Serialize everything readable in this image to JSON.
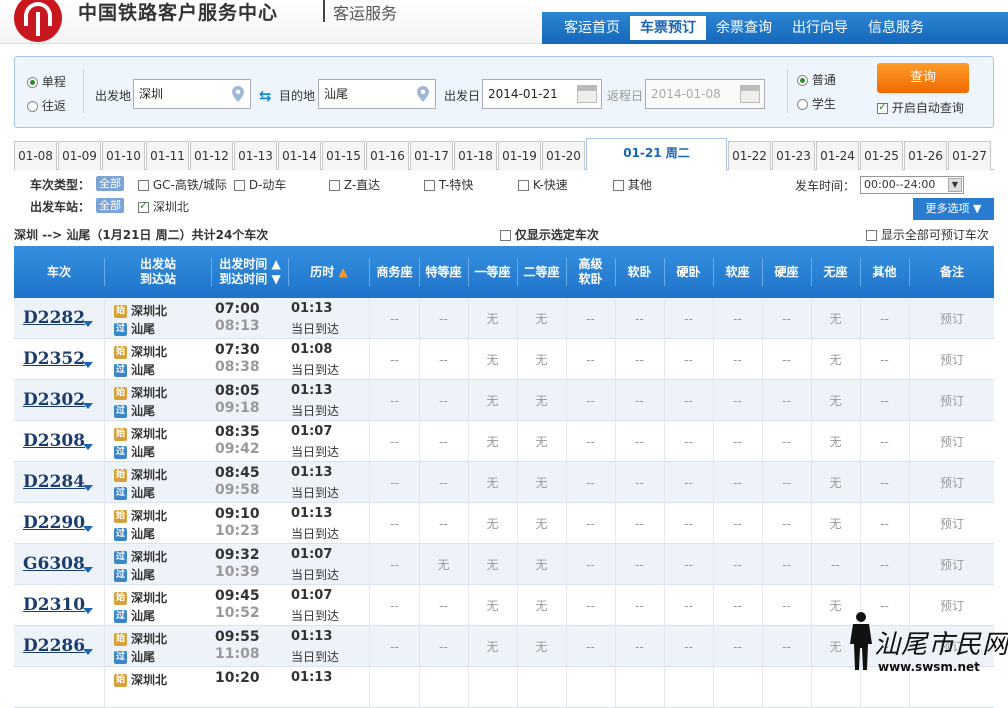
{
  "header": {
    "site_title": "中国铁路客户服务中心",
    "site_sub": "客运服务",
    "nav": [
      "客运首页",
      "车票预订",
      "余票查询",
      "出行向导",
      "信息服务"
    ],
    "active_nav": 1
  },
  "search": {
    "trip_types": [
      "单程",
      "往返"
    ],
    "from_label": "出发地",
    "from_value": "深圳",
    "to_label": "目的地",
    "to_value": "汕尾",
    "date_label": "出发日",
    "date_value": "2014-01-21",
    "return_label": "返程日",
    "return_value": "2014-01-08",
    "passenger_types": [
      "普通",
      "学生"
    ],
    "query_button": "查询",
    "auto_query_label": "开启自动查询"
  },
  "date_tabs": [
    "01-08",
    "01-09",
    "01-10",
    "01-11",
    "01-12",
    "01-13",
    "01-14",
    "01-15",
    "01-16",
    "01-17",
    "01-18",
    "01-19",
    "01-20",
    "01-21 周二",
    "01-22",
    "01-23",
    "01-24",
    "01-25",
    "01-26",
    "01-27"
  ],
  "active_date": 13,
  "filters": {
    "type_label": "车次类型：",
    "all_label": "全部",
    "types": [
      "GC-高铁/城际",
      "D-动车",
      "Z-直达",
      "T-特快",
      "K-快速",
      "其他"
    ],
    "station_label": "出发车站：",
    "station_all": "全部",
    "station": "深圳北",
    "time_label": "发车时间：",
    "time_value": "00:00--24:00",
    "more_options": "更多选项"
  },
  "summary": {
    "route": "深圳 --> 汕尾（1月21日  周二）共计24个车次",
    "only_selected": "仅显示选定车次",
    "show_all": "显示全部可预订车次"
  },
  "table": {
    "headers": {
      "train": "车次",
      "station_top": "出发站",
      "station_bottom": "到达站",
      "time_top": "出发时间",
      "time_bottom": "到达时间",
      "duration": "历时",
      "business": "商务座",
      "special": "特等座",
      "first": "一等座",
      "second": "二等座",
      "soft_sleeper_top": "高级",
      "soft_sleeper_bottom": "软卧",
      "soft_sleeper": "软卧",
      "hard_sleeper": "硬卧",
      "soft_seat": "软座",
      "hard_seat": "硬座",
      "no_seat": "无座",
      "other": "其他",
      "remark": "备注"
    },
    "badges": {
      "start": "始",
      "pass": "过"
    },
    "rows": [
      {
        "train": "D2282",
        "from": "深圳北",
        "to": "汕尾",
        "dep": "07:00",
        "arr": "08:13",
        "dur": "01:13",
        "day": "当日到达",
        "seats": [
          "--",
          "--",
          "无",
          "无",
          "--",
          "--",
          "--",
          "--",
          "--",
          "无",
          "--"
        ],
        "remark": "预订"
      },
      {
        "train": "D2352",
        "from": "深圳北",
        "to": "汕尾",
        "dep": "07:30",
        "arr": "08:38",
        "dur": "01:08",
        "day": "当日到达",
        "seats": [
          "--",
          "--",
          "无",
          "无",
          "--",
          "--",
          "--",
          "--",
          "--",
          "无",
          "--"
        ],
        "remark": "预订"
      },
      {
        "train": "D2302",
        "from": "深圳北",
        "to": "汕尾",
        "dep": "08:05",
        "arr": "09:18",
        "dur": "01:13",
        "day": "当日到达",
        "seats": [
          "--",
          "--",
          "无",
          "无",
          "--",
          "--",
          "--",
          "--",
          "--",
          "无",
          "--"
        ],
        "remark": "预订"
      },
      {
        "train": "D2308",
        "from": "深圳北",
        "to": "汕尾",
        "dep": "08:35",
        "arr": "09:42",
        "dur": "01:07",
        "day": "当日到达",
        "seats": [
          "--",
          "--",
          "无",
          "无",
          "--",
          "--",
          "--",
          "--",
          "--",
          "无",
          "--"
        ],
        "remark": "预订"
      },
      {
        "train": "D2284",
        "from": "深圳北",
        "to": "汕尾",
        "dep": "08:45",
        "arr": "09:58",
        "dur": "01:13",
        "day": "当日到达",
        "seats": [
          "--",
          "--",
          "无",
          "无",
          "--",
          "--",
          "--",
          "--",
          "--",
          "无",
          "--"
        ],
        "remark": "预订"
      },
      {
        "train": "D2290",
        "from": "深圳北",
        "to": "汕尾",
        "dep": "09:10",
        "arr": "10:23",
        "dur": "01:13",
        "day": "当日到达",
        "seats": [
          "--",
          "--",
          "无",
          "无",
          "--",
          "--",
          "--",
          "--",
          "--",
          "无",
          "--"
        ],
        "remark": "预订"
      },
      {
        "train": "G6308",
        "from": "深圳北",
        "to": "汕尾",
        "dep": "09:32",
        "arr": "10:39",
        "dur": "01:07",
        "day": "当日到达",
        "seats": [
          "--",
          "无",
          "无",
          "无",
          "--",
          "--",
          "--",
          "--",
          "--",
          "--",
          "--"
        ],
        "remark": "预订"
      },
      {
        "train": "D2310",
        "from": "深圳北",
        "to": "汕尾",
        "dep": "09:45",
        "arr": "10:52",
        "dur": "01:07",
        "day": "当日到达",
        "seats": [
          "--",
          "--",
          "无",
          "无",
          "--",
          "--",
          "--",
          "--",
          "--",
          "无",
          "--"
        ],
        "remark": "预订"
      },
      {
        "train": "D2286",
        "from": "深圳北",
        "to": "汕尾",
        "dep": "09:55",
        "arr": "11:08",
        "dur": "01:13",
        "day": "当日到达",
        "seats": [
          "--",
          "--",
          "无",
          "无",
          "--",
          "--",
          "--",
          "--",
          "--",
          "无",
          "--"
        ],
        "remark": "预订"
      },
      {
        "train": "",
        "from": "深圳北",
        "to": "",
        "dep": "10:20",
        "arr": "",
        "dur": "01:13",
        "day": "",
        "seats": [
          "",
          "",
          "",
          "",
          "",
          "",
          "",
          "",
          "",
          "",
          ""
        ],
        "remark": ""
      }
    ]
  },
  "watermark": {
    "text": "汕尾市民网",
    "url": "www.swsm.net"
  }
}
